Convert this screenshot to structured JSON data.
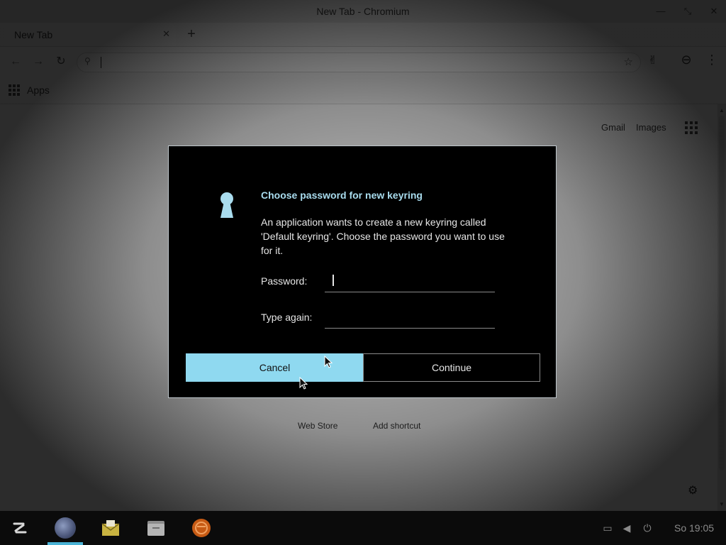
{
  "window": {
    "title": "New Tab - Chromium",
    "minimize_glyph": "—",
    "restore_glyph": "⤡",
    "close_glyph": "✕"
  },
  "tabs": [
    {
      "title": "New Tab",
      "close_glyph": "✕"
    }
  ],
  "new_tab_glyph": "+",
  "toolbar": {
    "back_glyph": "←",
    "forward_glyph": "→",
    "reload_glyph": "↻",
    "omnibox_value": "",
    "search_glyph": "⚲",
    "star_glyph": "☆",
    "extension_glyph": "✌",
    "profile_glyph": "⊖",
    "menu_glyph": "⋮"
  },
  "bookmarks": {
    "apps_label": "Apps"
  },
  "ntp": {
    "gmail_label": "Gmail",
    "images_label": "Images",
    "web_store_label": "Web Store",
    "add_shortcut_label": "Add shortcut",
    "customize_glyph": "⚙"
  },
  "dialog": {
    "title": "Choose password for new keyring",
    "message": "An application wants to create a new keyring called 'Default keyring'. Choose the password you want to use for it.",
    "password_label": "Password:",
    "password_value": "",
    "type_again_label": "Type again:",
    "type_again_value": "",
    "cancel_label": "Cancel",
    "continue_label": "Continue",
    "icon": "keyhole-icon",
    "accent_color": "#8fd9f0"
  },
  "taskbar": {
    "clock": "So 19:05",
    "apps": [
      "zorin-menu-icon",
      "chromium-icon",
      "mail-icon",
      "files-icon",
      "software-icon"
    ],
    "tray": [
      "display-icon",
      "volume-icon",
      "power-icon"
    ],
    "display_glyph": "▭",
    "volume_glyph": "◀",
    "power_glyph": "⏻"
  }
}
